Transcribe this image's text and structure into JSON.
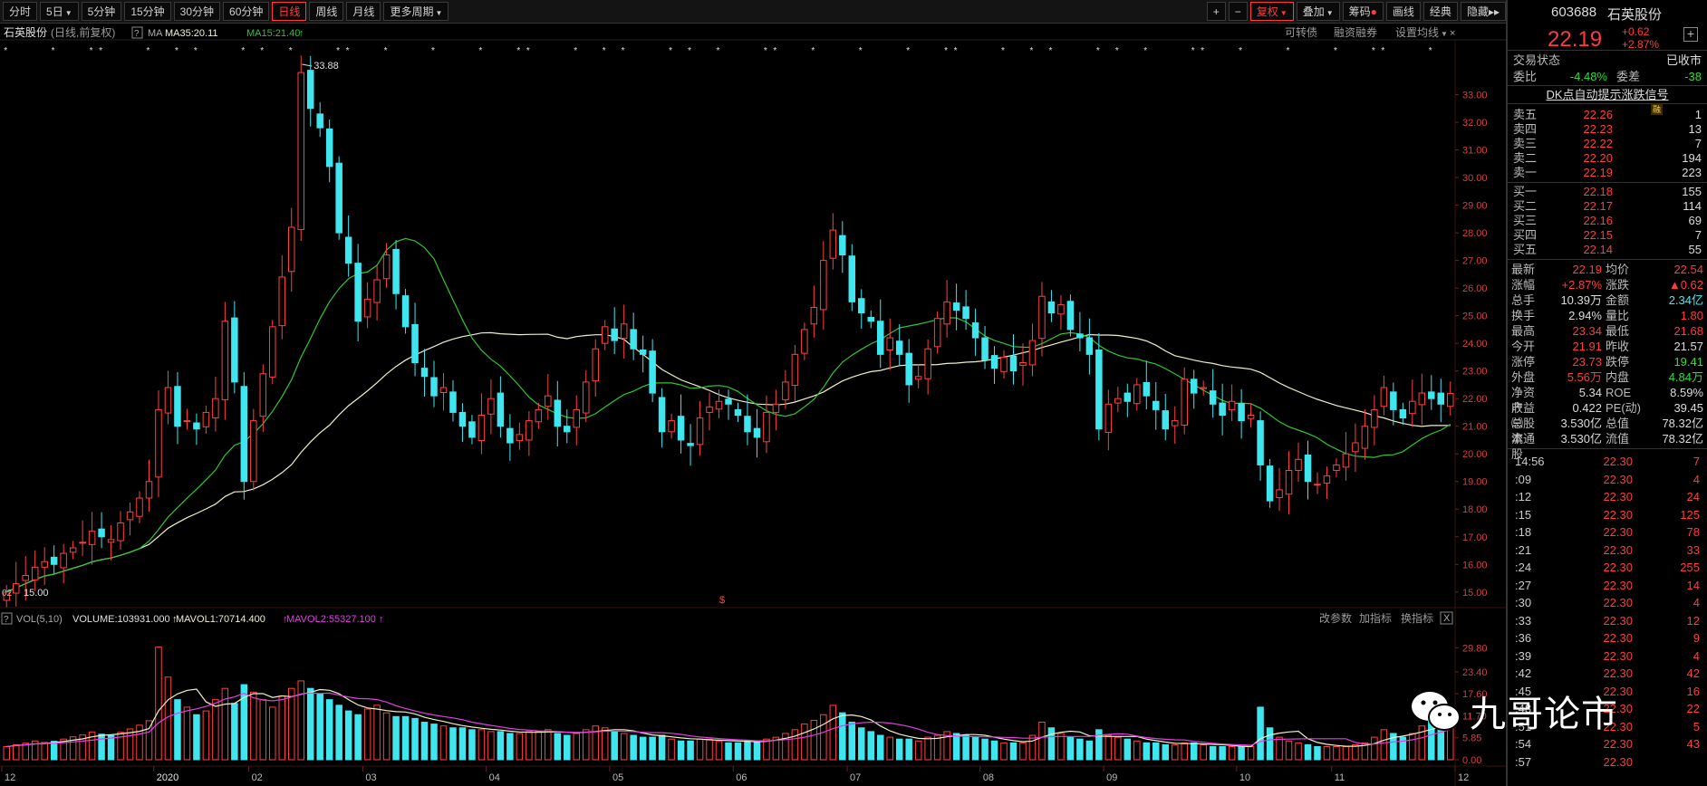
{
  "toolbar": {
    "periods": [
      "分时",
      "5日",
      "5分钟",
      "15分钟",
      "30分钟",
      "60分钟",
      "日线",
      "周线",
      "月线",
      "更多周期"
    ],
    "active_period": "日线",
    "right_buttons": [
      "复权",
      "叠加",
      "筹码",
      "画线",
      "经典",
      "隐藏"
    ]
  },
  "chart_header": {
    "stock_name": "石英股份",
    "mode": "(日线,前复权)",
    "help": "?",
    "ma_label": "MA",
    "ma35": "MA35:20.11",
    "ma15": "MA15:21.40",
    "right_links": [
      "可转债",
      "融资融券",
      "设置均线"
    ]
  },
  "annotations": {
    "high": "33.88",
    "low": "15.00",
    "low_prefix": "02",
    "mid_marker": "$"
  },
  "vol_header": {
    "label": "VOL(5,10)",
    "volume": "VOLUME:103931.000",
    "mavol1": "MAVOL1:70714.400",
    "mavol2": "MAVOL2:55327.100",
    "buttons": [
      "改参数",
      "加指标",
      "换指标"
    ],
    "close": "X"
  },
  "chart_data": {
    "type": "candlestick",
    "price_axis": [
      "33.00",
      "32.00",
      "31.00",
      "30.00",
      "29.00",
      "28.00",
      "27.00",
      "26.00",
      "25.00",
      "24.00",
      "23.00",
      "22.00",
      "21.00",
      "20.00",
      "19.00",
      "18.00",
      "17.00",
      "16.00",
      "15.00"
    ],
    "price_ylim": [
      14.6,
      34.0
    ],
    "vol_axis": [
      "29.80",
      "23.40",
      "17.60",
      "11.70",
      "5.85",
      "0.00"
    ],
    "vol_ylim": [
      0,
      34
    ],
    "x_labels": [
      "12",
      "2020",
      "02",
      "03",
      "04",
      "05",
      "06",
      "07",
      "08",
      "09",
      "10",
      "11",
      "12"
    ],
    "x_label_positions": [
      0,
      16,
      26,
      38,
      51,
      64,
      77,
      89,
      103,
      116,
      130,
      140,
      153
    ],
    "closes": [
      15.0,
      15.3,
      15.6,
      15.9,
      16.1,
      16.0,
      16.4,
      16.6,
      16.8,
      17.2,
      17.0,
      16.9,
      17.5,
      17.9,
      18.4,
      19.0,
      21.6,
      22.4,
      21.0,
      21.2,
      20.9,
      21.5,
      22.0,
      24.8,
      22.6,
      19.0,
      21.2,
      22.9,
      24.6,
      26.4,
      28.2,
      33.8,
      32.5,
      31.8,
      30.4,
      28.0,
      26.9,
      24.8,
      25.6,
      26.3,
      27.2,
      25.8,
      24.6,
      23.3,
      22.8,
      22.1,
      22.4,
      21.5,
      21.0,
      20.6,
      21.4,
      22.0,
      21.0,
      20.4,
      20.7,
      21.2,
      21.6,
      22.1,
      21.0,
      20.8,
      21.6,
      22.6,
      23.8,
      24.6,
      24.1,
      24.7,
      23.8,
      23.6,
      22.2,
      20.8,
      21.2,
      20.5,
      20.3,
      21.3,
      21.7,
      21.9,
      21.8,
      21.4,
      20.8,
      20.6,
      21.5,
      21.8,
      22.6,
      23.6,
      24.5,
      25.3,
      27.0,
      28.1,
      27.2,
      25.5,
      25.1,
      24.8,
      23.6,
      24.2,
      23.6,
      22.5,
      22.8,
      23.8,
      24.9,
      25.5,
      25.2,
      24.9,
      24.2,
      23.4,
      23.1,
      23.5,
      23.0,
      23.3,
      24.1,
      25.7,
      25.1,
      25.4,
      24.5,
      24.2,
      23.6,
      20.9,
      21.8,
      22.0,
      21.9,
      22.5,
      22.1,
      21.6,
      20.9,
      21.2,
      22.7,
      22.2,
      22.4,
      21.8,
      21.4,
      21.9,
      21.2,
      21.4,
      19.6,
      18.3,
      18.7,
      19.4,
      19.8,
      19.0,
      18.9,
      19.2,
      19.6,
      20.0,
      20.4,
      21.0,
      21.6,
      22.4,
      21.6,
      21.3,
      21.9,
      22.2,
      22.0,
      21.8,
      22.19
    ],
    "volumes": [
      3.5,
      4.0,
      4.4,
      5.0,
      4.6,
      4.9,
      5.5,
      6.1,
      6.6,
      7.4,
      6.8,
      6.4,
      7.3,
      8.2,
      9.2,
      10.4,
      30.0,
      22.0,
      16.0,
      14.0,
      12.0,
      13.0,
      16.0,
      19.0,
      15.0,
      20.0,
      18.0,
      16.0,
      14.0,
      17.0,
      19.0,
      21.0,
      19.0,
      17.5,
      16.0,
      14.5,
      13.0,
      12.0,
      13.5,
      14.5,
      12.5,
      11.5,
      11.5,
      11.0,
      10.0,
      9.5,
      9.0,
      8.5,
      8.5,
      8.0,
      8.0,
      7.5,
      7.5,
      7.0,
      7.0,
      7.5,
      7.5,
      8.0,
      7.0,
      6.5,
      7.0,
      8.0,
      9.0,
      8.5,
      7.5,
      7.0,
      6.5,
      6.0,
      6.0,
      6.5,
      5.5,
      5.0,
      5.0,
      5.5,
      5.5,
      5.0,
      4.5,
      4.5,
      5.0,
      5.0,
      5.5,
      6.0,
      7.0,
      8.0,
      9.5,
      10.5,
      12.0,
      14.5,
      12.5,
      10.0,
      8.5,
      7.5,
      6.5,
      6.0,
      5.5,
      5.5,
      5.0,
      6.0,
      6.5,
      7.5,
      7.0,
      6.5,
      6.0,
      5.5,
      5.0,
      4.5,
      4.5,
      4.5,
      6.5,
      10.0,
      8.5,
      7.0,
      6.0,
      5.5,
      5.0,
      8.0,
      6.5,
      6.0,
      5.5,
      5.0,
      4.5,
      4.5,
      4.0,
      4.0,
      4.5,
      4.5,
      4.0,
      3.5,
      3.5,
      3.5,
      3.5,
      3.5,
      14.0,
      8.5,
      6.0,
      5.0,
      4.5,
      4.0,
      3.5,
      3.5,
      3.5,
      3.5,
      4.0,
      4.5,
      6.0,
      8.0,
      7.0,
      6.0,
      7.0,
      9.0,
      11.5,
      10.0,
      12.0
    ]
  },
  "quote": {
    "code": "603688",
    "name": "石英股份",
    "price": "22.19",
    "change": "+0.62",
    "change_pct": "+2.87%",
    "plus": "+",
    "status_label": "交易状态",
    "status_value": "已收市",
    "wb_label": "委比",
    "wb_value": "-4.48%",
    "wc_label": "委差",
    "wc_value": "-38",
    "signal": "DK点自动提示涨跌信号",
    "rong": "融"
  },
  "orderbook": {
    "asks": [
      {
        "label": "卖五",
        "price": "22.26",
        "vol": "1"
      },
      {
        "label": "卖四",
        "price": "22.23",
        "vol": "13"
      },
      {
        "label": "卖三",
        "price": "22.22",
        "vol": "7"
      },
      {
        "label": "卖二",
        "price": "22.20",
        "vol": "194"
      },
      {
        "label": "卖一",
        "price": "22.19",
        "vol": "223"
      }
    ],
    "bids": [
      {
        "label": "买一",
        "price": "22.18",
        "vol": "155"
      },
      {
        "label": "买二",
        "price": "22.17",
        "vol": "114"
      },
      {
        "label": "买三",
        "price": "22.16",
        "vol": "69"
      },
      {
        "label": "买四",
        "price": "22.15",
        "vol": "7"
      },
      {
        "label": "买五",
        "price": "22.14",
        "vol": "55"
      }
    ]
  },
  "stats": [
    {
      "k1": "最新",
      "v1": "22.19",
      "c1": "red",
      "k2": "均价",
      "v2": "22.54",
      "c2": "red"
    },
    {
      "k1": "涨幅",
      "v1": "+2.87%",
      "c1": "red",
      "k2": "涨跌",
      "v2": "▲0.62",
      "c2": "red"
    },
    {
      "k1": "总手",
      "v1": "10.39万",
      "c1": "wht",
      "k2": "金额",
      "v2": "2.34亿",
      "c2": "cyan"
    },
    {
      "k1": "换手",
      "v1": "2.94%",
      "c1": "wht",
      "k2": "量比",
      "v2": "1.80",
      "c2": "red"
    },
    {
      "k1": "最高",
      "v1": "23.34",
      "c1": "red",
      "k2": "最低",
      "v2": "21.68",
      "c2": "red"
    },
    {
      "k1": "今开",
      "v1": "21.91",
      "c1": "red",
      "k2": "昨收",
      "v2": "21.57",
      "c2": "wht"
    },
    {
      "k1": "涨停",
      "v1": "23.73",
      "c1": "red",
      "k2": "跌停",
      "v2": "19.41",
      "c2": "grn"
    },
    {
      "k1": "外盘",
      "v1": "5.56万",
      "c1": "red",
      "k2": "内盘",
      "v2": "4.84万",
      "c2": "grn"
    },
    {
      "k1": "净资产",
      "v1": "5.34",
      "c1": "wht",
      "k2": "ROE",
      "v2": "8.59%",
      "c2": "wht"
    },
    {
      "k1": "收益㈢",
      "v1": "0.422",
      "c1": "wht",
      "k2": "PE(动)",
      "v2": "39.45",
      "c2": "wht"
    },
    {
      "k1": "总股本",
      "v1": "3.530亿",
      "c1": "wht",
      "k2": "总值",
      "v2": "78.32亿",
      "c2": "wht"
    },
    {
      "k1": "流通股",
      "v1": "3.530亿",
      "c1": "wht",
      "k2": "流值",
      "v2": "78.32亿",
      "c2": "wht"
    }
  ],
  "ticks": [
    {
      "t": "14:56",
      "p": "22.30",
      "v": "7",
      "c": "red"
    },
    {
      "t": ":09",
      "p": "22.30",
      "v": "4",
      "c": "red"
    },
    {
      "t": ":12",
      "p": "22.30",
      "v": "24",
      "c": "red"
    },
    {
      "t": ":15",
      "p": "22.30",
      "v": "125",
      "c": "red"
    },
    {
      "t": ":18",
      "p": "22.30",
      "v": "78",
      "c": "red"
    },
    {
      "t": ":21",
      "p": "22.30",
      "v": "33",
      "c": "red"
    },
    {
      "t": ":24",
      "p": "22.30",
      "v": "255",
      "c": "red"
    },
    {
      "t": ":27",
      "p": "22.30",
      "v": "14",
      "c": "red"
    },
    {
      "t": ":30",
      "p": "22.30",
      "v": "4",
      "c": "red"
    },
    {
      "t": ":33",
      "p": "22.30",
      "v": "12",
      "c": "red"
    },
    {
      "t": ":36",
      "p": "22.30",
      "v": "9",
      "c": "red"
    },
    {
      "t": ":39",
      "p": "22.30",
      "v": "4",
      "c": "red"
    },
    {
      "t": ":42",
      "p": "22.30",
      "v": "42",
      "c": "red"
    },
    {
      "t": ":45",
      "p": "22.30",
      "v": "16",
      "c": "red"
    },
    {
      "t": ":48",
      "p": "22.30",
      "v": "22",
      "c": "red"
    },
    {
      "t": ":51",
      "p": "22.30",
      "v": "5",
      "c": "red"
    },
    {
      "t": ":54",
      "p": "22.30",
      "v": "43",
      "c": "red"
    },
    {
      "t": ":57",
      "p": "22.30",
      "v": "",
      "c": "red"
    }
  ],
  "watermark": "九哥论市",
  "colors": {
    "up": "#ff4040",
    "down": "#3fe6f0",
    "ma15": "#2fc62f",
    "ma35": "#f0f0c8"
  }
}
